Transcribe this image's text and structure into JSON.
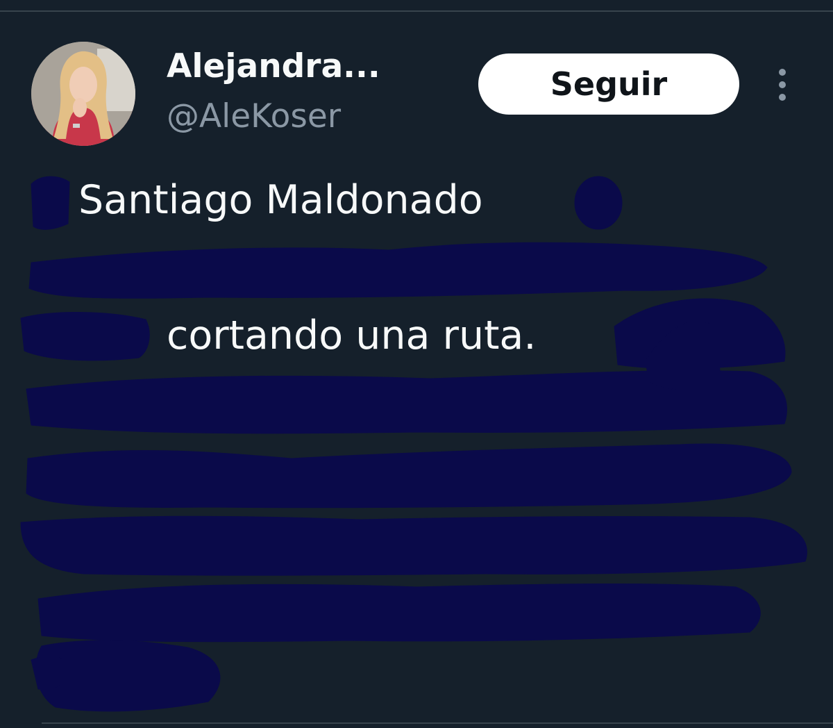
{
  "author": {
    "display_name": "Alejandra...",
    "handle": "@AleKoser",
    "avatar_icon": "profile-photo"
  },
  "actions": {
    "follow_label": "Seguir",
    "more_icon": "more-vertical-icon"
  },
  "tweet": {
    "visible_lines": [
      "Santiago Maldonado",
      "cortando una ruta."
    ]
  },
  "colors": {
    "background": "#15202b",
    "text": "#f7f9f9",
    "muted": "#8b98a5",
    "redaction": "#0a0a4a"
  }
}
